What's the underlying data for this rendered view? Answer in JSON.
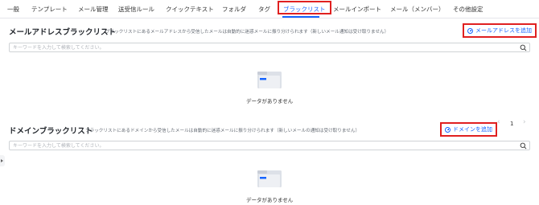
{
  "tabs": [
    {
      "label": "一般"
    },
    {
      "label": "テンプレート"
    },
    {
      "label": "メール管理"
    },
    {
      "label": "送受信ルール"
    },
    {
      "label": "クイックテキスト"
    },
    {
      "label": "フォルダ"
    },
    {
      "label": "タグ"
    },
    {
      "label": "ブラックリスト",
      "active": true
    },
    {
      "label": "メールインポート"
    },
    {
      "label": "メール（メンバー）"
    },
    {
      "label": "その他設定"
    }
  ],
  "email_blacklist": {
    "title": "メールアドレスブラックリスト",
    "description": "ブラックリストにあるメールアドレスから受信したメールは自動的に迷惑メールに振り分けられます（新しいメール通知は受け取りません）",
    "add_label": "メールアドレスを追加",
    "search_placeholder": "キーワードを入力して検索してください。",
    "empty_text": "データがありません"
  },
  "domain_blacklist": {
    "title": "ドメインブラックリスト",
    "description": "ブラックリストにあるドメインから受信したメールは自動的に迷惑メールに振り分けられます（新しいメールの通知は受け取りません）",
    "add_label": "ドメインを追加",
    "search_placeholder": "キーワードを入力して検索してください。",
    "empty_text": "データがありません",
    "page": "1"
  },
  "colors": {
    "accent": "#1664ff",
    "highlight": "#e02020"
  },
  "icons": {
    "search": "search-icon",
    "add": "plus-circle-icon",
    "empty": "empty-folder-icon",
    "prev": "chevron-left-icon",
    "next": "chevron-right-icon",
    "sidebar": "expand-arrow-icon"
  }
}
